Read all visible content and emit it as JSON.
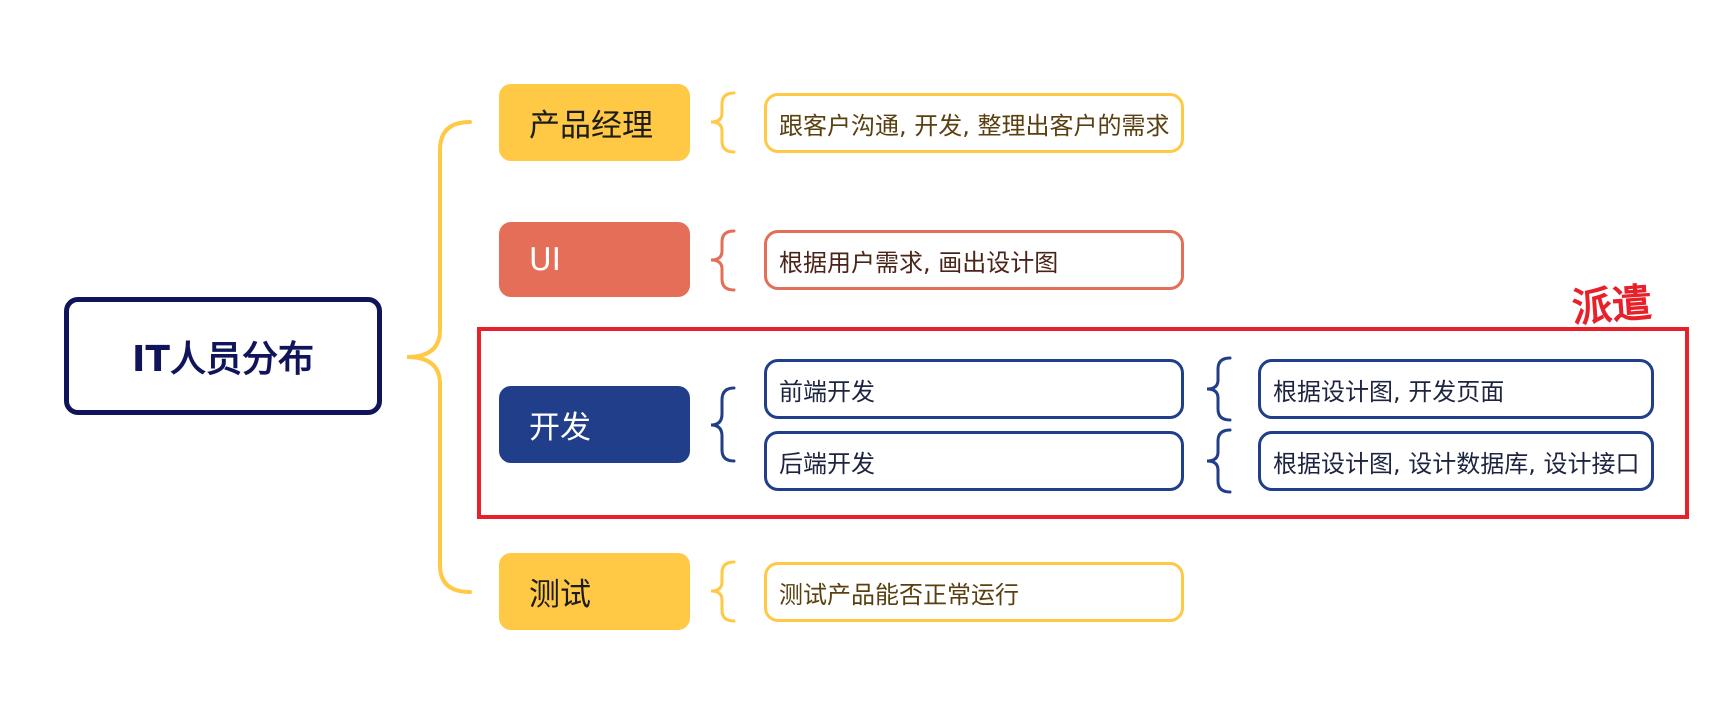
{
  "root": {
    "label": "IT人员分布"
  },
  "categories": {
    "pm": {
      "label": "产品经理",
      "description": "跟客户沟通, 开发, 整理出客户的需求"
    },
    "ui": {
      "label": "UI",
      "description": "根据用户需求, 画出设计图"
    },
    "dev": {
      "label": "开发",
      "frontend": {
        "label": "前端开发",
        "description": "根据设计图, 开发页面"
      },
      "backend": {
        "label": "后端开发",
        "description": "根据设计图, 设计数据库, 设计接口"
      }
    },
    "test": {
      "label": "测试",
      "description": "测试产品能否正常运行"
    }
  },
  "annotation": {
    "text": "派遣"
  },
  "colors": {
    "root": "#10145a",
    "yellow": "#ffc845",
    "coral": "#e46e57",
    "navy": "#213e8a",
    "highlight": "#e8202a"
  }
}
